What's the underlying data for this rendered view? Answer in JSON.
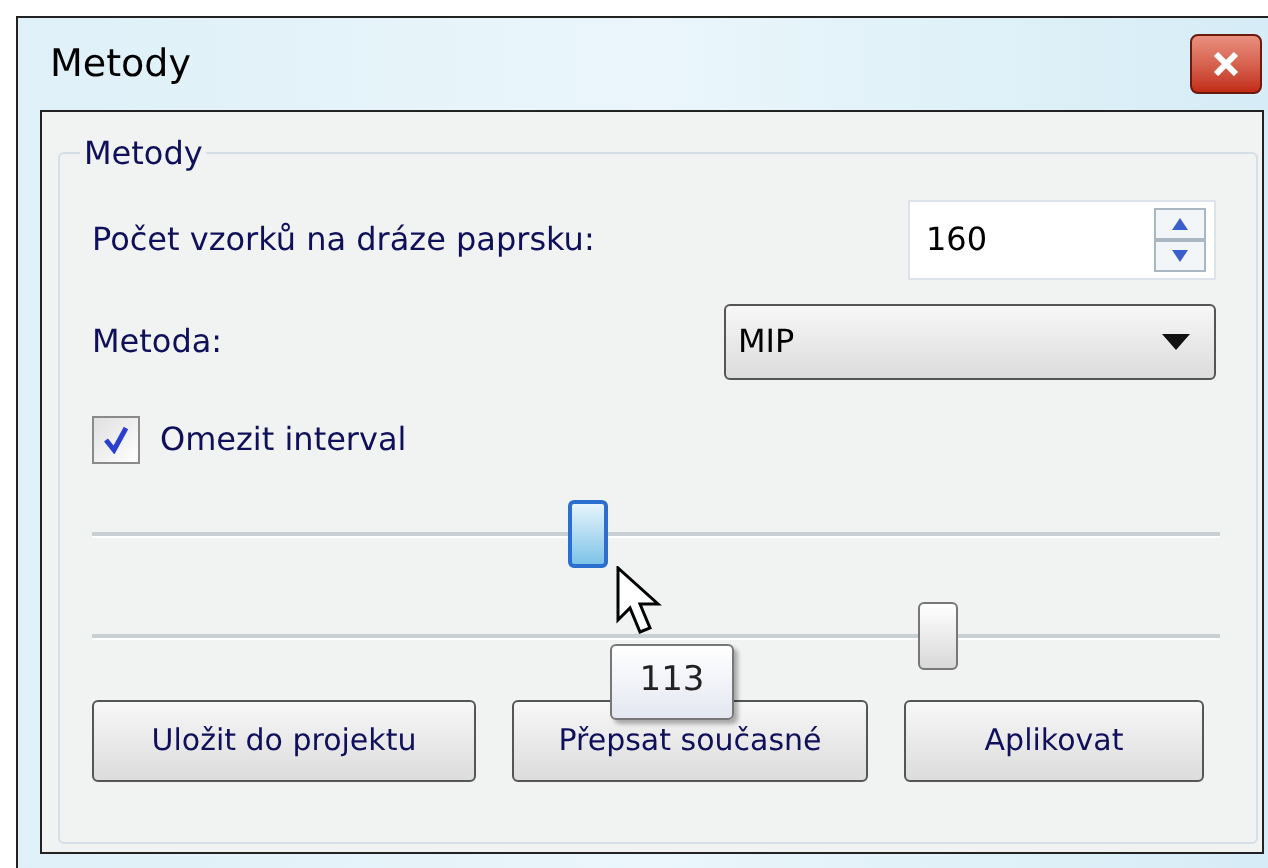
{
  "window": {
    "title": "Metody"
  },
  "group": {
    "title": "Metody"
  },
  "samples": {
    "label": "Počet vzorků na dráze paprsku:",
    "value": "160"
  },
  "method": {
    "label": "Metoda:",
    "value": "MIP"
  },
  "limit": {
    "label": "Omezit interval",
    "checked": true
  },
  "sliders": [
    {
      "level": 0.44
    },
    {
      "level": 0.75
    }
  ],
  "tooltip": "113",
  "buttons": [
    "Uložit do projektu",
    "Přepsat současné",
    "Aplikovat"
  ]
}
